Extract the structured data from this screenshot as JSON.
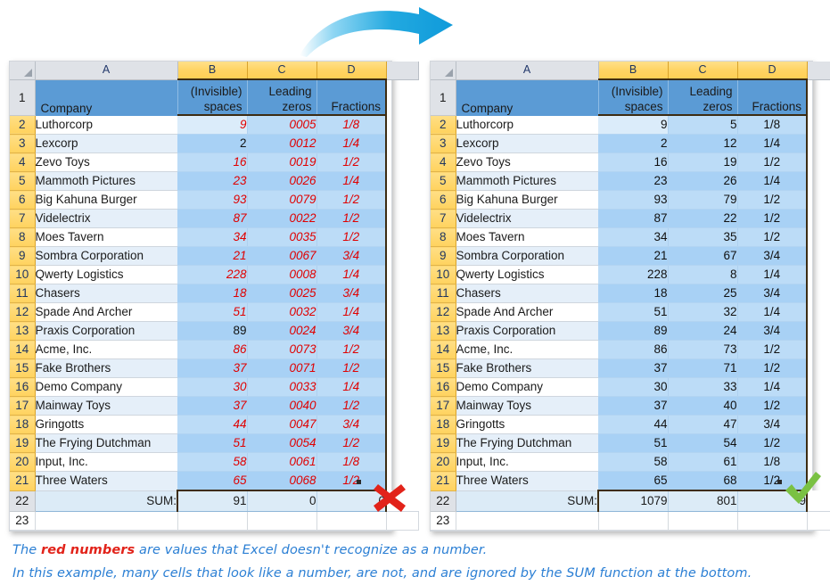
{
  "figure": {
    "arrow_icon": "curved-right-arrow",
    "arrow_color": "#29abe2"
  },
  "columns": {
    "corner": "",
    "letters": [
      "A",
      "B",
      "C",
      "D",
      ""
    ]
  },
  "header_row": {
    "row_number": "1",
    "company": "Company",
    "b_line1": "(Invisible)",
    "b_line2": "spaces",
    "c_line1": "Leading",
    "c_line2": "zeros",
    "d_line1": "",
    "d_line2": "Fractions"
  },
  "rows": [
    {
      "n": "2",
      "company": "Luthorcorp",
      "b": "9",
      "c_text": "0005",
      "c_num": "5",
      "d": "1/8",
      "b_is_text": true,
      "c_is_text": true,
      "d_is_text": true
    },
    {
      "n": "3",
      "company": "Lexcorp",
      "b": "2",
      "c_text": "0012",
      "c_num": "12",
      "d": "1/4",
      "b_is_text": false,
      "c_is_text": true,
      "d_is_text": true
    },
    {
      "n": "4",
      "company": "Zevo Toys",
      "b": "16",
      "c_text": "0019",
      "c_num": "19",
      "d": "1/2",
      "b_is_text": true,
      "c_is_text": true,
      "d_is_text": true
    },
    {
      "n": "5",
      "company": "Mammoth Pictures",
      "b": "23",
      "c_text": "0026",
      "c_num": "26",
      "d": "1/4",
      "b_is_text": true,
      "c_is_text": true,
      "d_is_text": true
    },
    {
      "n": "6",
      "company": "Big Kahuna Burger",
      "b": "93",
      "c_text": "0079",
      "c_num": "79",
      "d": "1/2",
      "b_is_text": true,
      "c_is_text": true,
      "d_is_text": true
    },
    {
      "n": "7",
      "company": "Videlectrix",
      "b": "87",
      "c_text": "0022",
      "c_num": "22",
      "d": "1/2",
      "b_is_text": true,
      "c_is_text": true,
      "d_is_text": true
    },
    {
      "n": "8",
      "company": "Moes Tavern",
      "b": "34",
      "c_text": "0035",
      "c_num": "35",
      "d": "1/2",
      "b_is_text": true,
      "c_is_text": true,
      "d_is_text": true
    },
    {
      "n": "9",
      "company": "Sombra Corporation",
      "b": "21",
      "c_text": "0067",
      "c_num": "67",
      "d": "3/4",
      "b_is_text": true,
      "c_is_text": true,
      "d_is_text": true
    },
    {
      "n": "10",
      "company": "Qwerty Logistics",
      "b": "228",
      "c_text": "0008",
      "c_num": "8",
      "d": "1/4",
      "b_is_text": true,
      "c_is_text": true,
      "d_is_text": true
    },
    {
      "n": "11",
      "company": "Chasers",
      "b": "18",
      "c_text": "0025",
      "c_num": "25",
      "d": "3/4",
      "b_is_text": true,
      "c_is_text": true,
      "d_is_text": true
    },
    {
      "n": "12",
      "company": "Spade And Archer",
      "b": "51",
      "c_text": "0032",
      "c_num": "32",
      "d": "1/4",
      "b_is_text": true,
      "c_is_text": true,
      "d_is_text": true
    },
    {
      "n": "13",
      "company": "Praxis Corporation",
      "b": "89",
      "c_text": "0024",
      "c_num": "24",
      "d": "3/4",
      "b_is_text": false,
      "c_is_text": true,
      "d_is_text": true
    },
    {
      "n": "14",
      "company": "Acme, Inc.",
      "b": "86",
      "c_text": "0073",
      "c_num": "73",
      "d": "1/2",
      "b_is_text": true,
      "c_is_text": true,
      "d_is_text": true
    },
    {
      "n": "15",
      "company": "Fake Brothers",
      "b": "37",
      "c_text": "0071",
      "c_num": "71",
      "d": "1/2",
      "b_is_text": true,
      "c_is_text": true,
      "d_is_text": true
    },
    {
      "n": "16",
      "company": "Demo Company",
      "b": "30",
      "c_text": "0033",
      "c_num": "33",
      "d": "1/4",
      "b_is_text": true,
      "c_is_text": true,
      "d_is_text": true
    },
    {
      "n": "17",
      "company": "Mainway Toys",
      "b": "37",
      "c_text": "0040",
      "c_num": "40",
      "d": "1/2",
      "b_is_text": true,
      "c_is_text": true,
      "d_is_text": true
    },
    {
      "n": "18",
      "company": "Gringotts",
      "b": "44",
      "c_text": "0047",
      "c_num": "47",
      "d": "3/4",
      "b_is_text": true,
      "c_is_text": true,
      "d_is_text": true
    },
    {
      "n": "19",
      "company": "The Frying Dutchman",
      "b": "51",
      "c_text": "0054",
      "c_num": "54",
      "d": "1/2",
      "b_is_text": true,
      "c_is_text": true,
      "d_is_text": true
    },
    {
      "n": "20",
      "company": "Input, Inc.",
      "b": "58",
      "c_text": "0061",
      "c_num": "61",
      "d": "1/8",
      "b_is_text": true,
      "c_is_text": true,
      "d_is_text": true
    },
    {
      "n": "21",
      "company": "Three Waters",
      "b": "65",
      "c_text": "0068",
      "c_num": "68",
      "d": "1/2",
      "b_is_text": true,
      "c_is_text": true,
      "d_is_text": true
    }
  ],
  "sum_row": {
    "row_number": "22",
    "label": "SUM:",
    "left": {
      "b": "91",
      "c": "0",
      "d": "0"
    },
    "right": {
      "b": "1079",
      "c": "801",
      "d": "9"
    }
  },
  "empty_row": {
    "row_number": "23"
  },
  "verdict": {
    "left_icon": "red-cross-icon",
    "left_color": "#e2231a",
    "right_icon": "green-check-icon",
    "right_color": "#7ac143"
  },
  "caption": {
    "line1_a": "The ",
    "line1_red": "red numbers",
    "line1_b": " are values that Excel doesn't recognize as a number.",
    "line2": "In this example, many cells that look like a number, are not, and are ignored by the SUM function at the bottom."
  },
  "colors": {
    "header_blue": "#5b9bd5",
    "selected_col_header": "#ffd464",
    "text_number_red": "#e00000",
    "cell_blue": "#bcdcf7"
  }
}
